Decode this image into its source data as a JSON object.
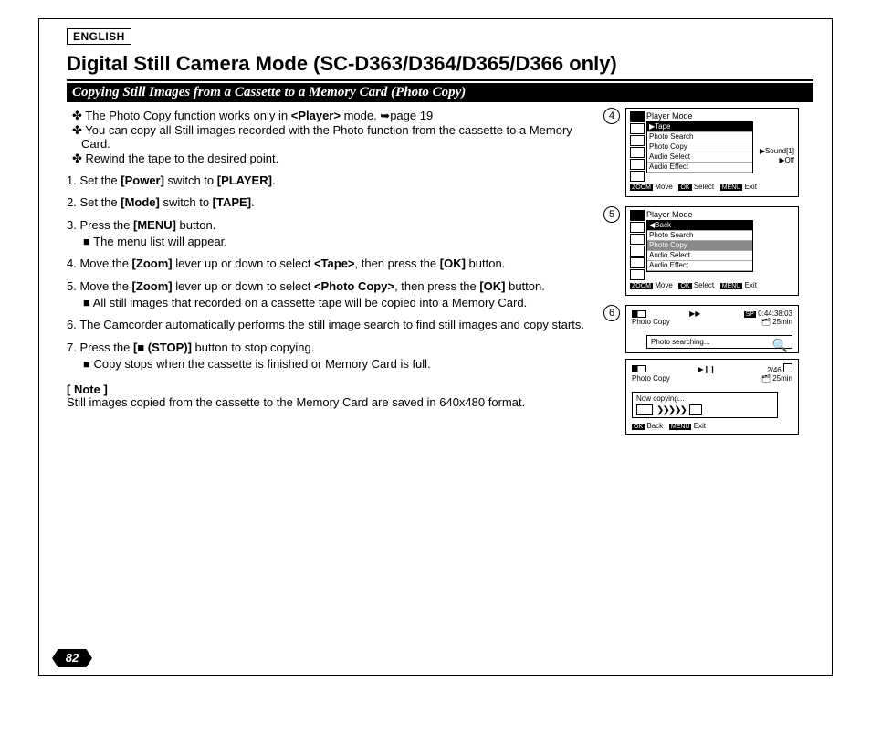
{
  "lang_tag": "ENGLISH",
  "title": "Digital Still Camera Mode (SC-D363/D364/D365/D366 only)",
  "subtitle": "Copying Still Images from a Cassette to a Memory Card (Photo Copy)",
  "intro": [
    "✤ The Photo Copy function works only in <Player> mode. ➥page 19",
    "✤ You can copy all Still images recorded with the Photo function from the cassette to a Memory Card.",
    "✤ Rewind the tape to the desired point."
  ],
  "steps": [
    {
      "text": "1. Set the [Power] switch to [PLAYER]."
    },
    {
      "text": "2. Set the [Mode] switch to [TAPE]."
    },
    {
      "text": "3. Press the [MENU] button.",
      "sub": "■  The menu list will appear."
    },
    {
      "text": "4. Move the [Zoom] lever up or down to select <Tape>, then press the [OK] button."
    },
    {
      "text": "5. Move the [Zoom] lever up or down to select <Photo Copy>, then press the [OK] button.",
      "sub": "■  All still images that recorded on a cassette tape will be copied into a Memory Card."
    },
    {
      "text": "6. The Camcorder automatically performs the still image search to find still images and copy starts."
    },
    {
      "text": "7. Press the [■ (STOP)] button to stop copying.",
      "sub": "■  Copy stops when the cassette is finished or Memory Card is full."
    }
  ],
  "note_head": "[ Note ]",
  "note_body": "Still images copied from the cassette to the Memory Card are saved in 640x480 format.",
  "page_number": "82",
  "fig4": {
    "num": "4",
    "title": "Player Mode",
    "rows": [
      "Tape",
      "Photo Search",
      "Photo Copy",
      "Audio Select",
      "Audio Effect"
    ],
    "side1": "▶Sound[1]",
    "side2": "▶Off",
    "footer_zoom": "ZOOM",
    "footer_move": "Move",
    "footer_ok": "OK",
    "footer_select": "Select",
    "footer_menu": "MENU",
    "footer_exit": "Exit"
  },
  "fig5": {
    "num": "5",
    "title": "Player Mode",
    "rows": [
      "Back",
      "Photo Search",
      "Photo Copy",
      "Audio Select",
      "Audio Effect"
    ],
    "footer_zoom": "ZOOM",
    "footer_move": "Move",
    "footer_ok": "OK",
    "footer_select": "Select",
    "footer_menu": "MENU",
    "footer_exit": "Exit"
  },
  "fig6": {
    "num": "6",
    "sp": "SP",
    "time": "0:44:38:03",
    "label": "Photo Copy",
    "remain": "25min",
    "status": "Photo searching...",
    "ff": "▶▶"
  },
  "fig7": {
    "count": "2/46",
    "label": "Photo Copy",
    "remain": "25min",
    "status": "Now copying...",
    "pause": "▶❙❙",
    "ok": "OK",
    "back": "Back",
    "menu": "MENU",
    "exit": "Exit"
  }
}
